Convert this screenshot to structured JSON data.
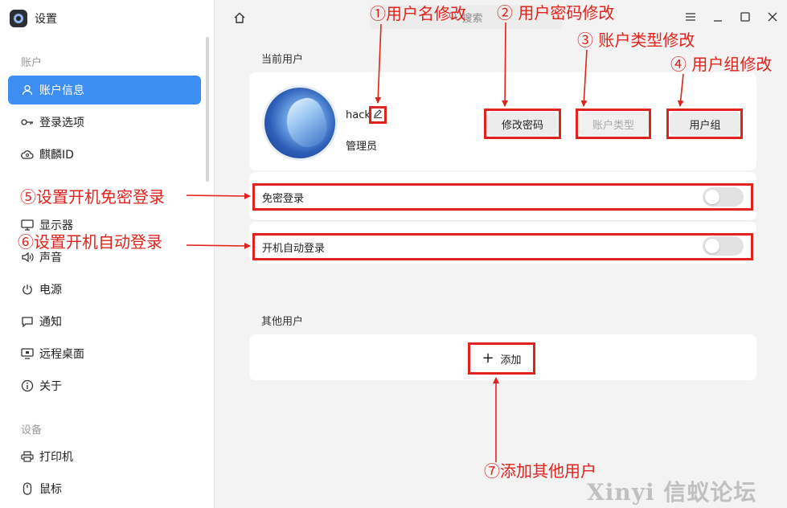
{
  "window": {
    "title": "设置",
    "search_placeholder": "搜索"
  },
  "sidebar": {
    "section_account": "账户",
    "section_device": "设备",
    "items": [
      {
        "label": "账户信息",
        "icon": "user-icon"
      },
      {
        "label": "登录选项",
        "icon": "key-icon"
      },
      {
        "label": "麒麟ID",
        "icon": "cloud-id-icon"
      },
      {
        "label": "显示器",
        "icon": "monitor-icon"
      },
      {
        "label": "声音",
        "icon": "speaker-icon"
      },
      {
        "label": "电源",
        "icon": "power-icon"
      },
      {
        "label": "通知",
        "icon": "notification-icon"
      },
      {
        "label": "远程桌面",
        "icon": "remote-desktop-icon"
      },
      {
        "label": "关于",
        "icon": "info-icon"
      },
      {
        "label": "打印机",
        "icon": "printer-icon"
      },
      {
        "label": "鼠标",
        "icon": "mouse-icon"
      }
    ]
  },
  "current_user": {
    "group_title": "当前用户",
    "username": "hack",
    "role": "管理员",
    "change_password_button": "修改密码",
    "account_type_button": "账户类型",
    "user_group_button": "用户组",
    "passwordless_login_label": "免密登录",
    "passwordless_login_enabled": false,
    "auto_login_label": "开机自动登录",
    "auto_login_enabled": false
  },
  "other_users": {
    "group_title": "其他用户",
    "add_button": "添加"
  },
  "annotations": {
    "a1": "①用户名修改",
    "a2": "② 用户密码修改",
    "a3": "③ 账户类型修改",
    "a4": "④ 用户组修改",
    "a5": "⑤设置开机免密登录",
    "a6": "⑥设置开机自动登录",
    "a7": "⑦添加其他用户"
  },
  "watermark": "Xinyi 信蚁论坛",
  "colors": {
    "accent": "#3d8ef3",
    "annotation_red": "#e0231c"
  }
}
